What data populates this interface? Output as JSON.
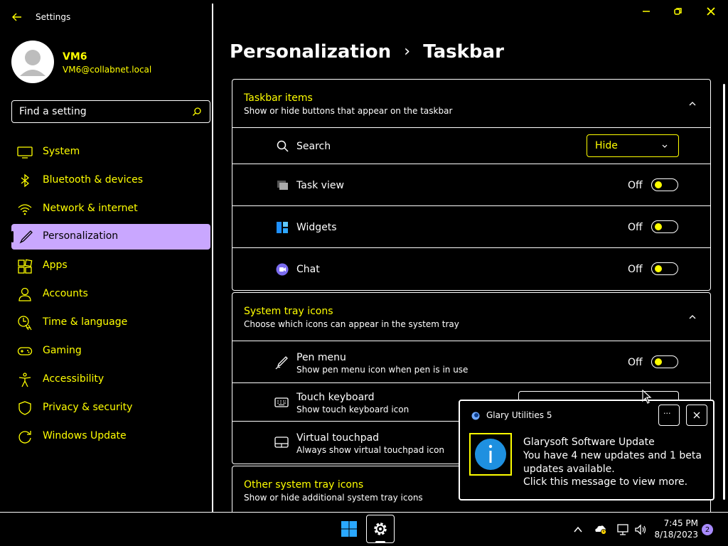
{
  "window": {
    "title": "Settings",
    "controls": {
      "minimize": "minimize-icon",
      "restore": "restore-icon",
      "close": "close-icon"
    }
  },
  "user": {
    "name": "VM6",
    "email": "VM6@collabnet.local"
  },
  "search": {
    "placeholder": "Find a setting"
  },
  "nav": {
    "items": [
      {
        "label": "System",
        "icon": "monitor-icon"
      },
      {
        "label": "Bluetooth & devices",
        "icon": "bluetooth-icon"
      },
      {
        "label": "Network & internet",
        "icon": "wifi-icon"
      },
      {
        "label": "Personalization",
        "icon": "brush-icon",
        "active": true
      },
      {
        "label": "Apps",
        "icon": "apps-icon"
      },
      {
        "label": "Accounts",
        "icon": "person-icon"
      },
      {
        "label": "Time & language",
        "icon": "globe-clock-icon"
      },
      {
        "label": "Gaming",
        "icon": "gamepad-icon"
      },
      {
        "label": "Accessibility",
        "icon": "accessibility-icon"
      },
      {
        "label": "Privacy & security",
        "icon": "shield-icon"
      },
      {
        "label": "Windows Update",
        "icon": "update-icon"
      }
    ]
  },
  "breadcrumb": {
    "parent": "Personalization",
    "separator": "›",
    "current": "Taskbar"
  },
  "taskbar_items": {
    "title": "Taskbar items",
    "description": "Show or hide buttons that appear on the taskbar",
    "search": {
      "label": "Search",
      "value": "Hide"
    },
    "task_view": {
      "label": "Task view",
      "state": "Off"
    },
    "widgets": {
      "label": "Widgets",
      "state": "Off"
    },
    "chat": {
      "label": "Chat",
      "state": "Off"
    }
  },
  "system_tray": {
    "title": "System tray icons",
    "description": "Choose which icons can appear in the system tray",
    "pen_menu": {
      "label": "Pen menu",
      "description": "Show pen menu icon when pen is in use",
      "state": "Off"
    },
    "touch_keyboard": {
      "label": "Touch keyboard",
      "description": "Show touch keyboard icon"
    },
    "virtual_touchpad": {
      "label": "Virtual touchpad",
      "description": "Always show virtual touchpad icon"
    }
  },
  "other_tray": {
    "title": "Other system tray icons",
    "description": "Show or hide additional system tray icons"
  },
  "toast": {
    "app": "Glary Utilities 5",
    "more": "···",
    "title": "Glarysoft Software Update",
    "line1": "You have 4 new updates and 1 beta",
    "line2": "updates available.",
    "line3": "Click this message to view more."
  },
  "clock": {
    "time": "7:45 PM",
    "date": "8/18/2023"
  },
  "notifications": {
    "count": "2"
  },
  "colors": {
    "accent_text": "#ffff00",
    "active_nav": "#c9a7ff",
    "info_blue": "#1e90e0",
    "badge": "#a98bff"
  }
}
